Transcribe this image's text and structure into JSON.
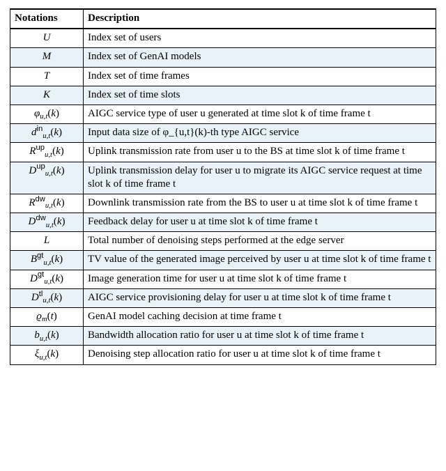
{
  "table": {
    "headers": {
      "notations": "Notations",
      "description": "Description"
    },
    "rows": [
      {
        "shade": false,
        "notation_html": "<span class='cal'>U</span>",
        "description": "Index set of users"
      },
      {
        "shade": true,
        "notation_html": "<span class='cal'>M</span>",
        "description": "Index set of GenAI models"
      },
      {
        "shade": false,
        "notation_html": "<span class='cal'>T</span>",
        "description": "Index set of time frames"
      },
      {
        "shade": true,
        "notation_html": "<span class='cal'>K</span>",
        "description": "Index set of time slots"
      },
      {
        "shade": false,
        "notation_html": "<span class='it'>φ</span><span class='sub it'>u,t</span>(<span class='it'>k</span>)",
        "description": "AIGC service type of user u generated at time slot k of time frame t"
      },
      {
        "shade": true,
        "notation_html": "<span class='it'>d</span><span class='sup up'>in</span><span class='sub it'>u,t</span>(<span class='it'>k</span>)",
        "description": "Input data size of φ_{u,t}(k)-th type AIGC service"
      },
      {
        "shade": false,
        "notation_html": "<span class='it'>R</span><span class='sup up'>up</span><span class='sub it'>u,t</span>(<span class='it'>k</span>)",
        "description": "Uplink transmission rate from user u to the BS at time slot k of time frame t"
      },
      {
        "shade": true,
        "notation_html": "<span class='it'>D</span><span class='sup up'>up</span><span class='sub it'>u,t</span>(<span class='it'>k</span>)",
        "description": "Uplink transmission delay for user u to migrate its AIGC service request at time slot k of time frame t"
      },
      {
        "shade": false,
        "notation_html": "<span class='it'>R</span><span class='sup up'>dw</span><span class='sub it'>u,t</span>(<span class='it'>k</span>)",
        "description": "Downlink transmission rate from the BS to user u at time slot k of time frame t"
      },
      {
        "shade": true,
        "notation_html": "<span class='it'>D</span><span class='sup up'>dw</span><span class='sub it'>u,t</span>(<span class='it'>k</span>)",
        "description": "Feedback delay for user u at time slot k of time frame t"
      },
      {
        "shade": false,
        "notation_html": "<span class='cal'>L</span>",
        "description": "Total number of denoising steps performed at the edge server"
      },
      {
        "shade": true,
        "notation_html": "<span class='it'>B</span><span class='sup up'>gt</span><span class='sub it'>u,t</span>(<span class='it'>k</span>)",
        "description": "TV value of the generated image perceived by user u at time slot k of time frame t"
      },
      {
        "shade": false,
        "notation_html": "<span class='it'>D</span><span class='sup up'>gt</span><span class='sub it'>u,t</span>(<span class='it'>k</span>)",
        "description": "Image generation time for user u at time slot k of time frame t"
      },
      {
        "shade": true,
        "notation_html": "<span class='it'>D</span><span class='sup up'>tl</span><span class='sub it'>u,t</span>(<span class='it'>k</span>)",
        "description": "AIGC service provisioning delay for user u at time slot k of time frame t"
      },
      {
        "shade": false,
        "notation_html": "<span class='it'>ϱ</span><span class='sub it'>m</span>(<span class='it'>t</span>)",
        "description": "GenAI model caching decision at time frame t"
      },
      {
        "shade": true,
        "notation_html": "<span class='it'>b</span><span class='sub it'>u,t</span>(<span class='it'>k</span>)",
        "description": "Bandwidth allocation ratio for user u at time slot k of time frame t"
      },
      {
        "shade": false,
        "notation_html": "<span class='it'>ξ</span><span class='sub it'>u,t</span>(<span class='it'>k</span>)",
        "description": "Denoising step allocation ratio for user u at time slot k of time frame t"
      }
    ]
  }
}
